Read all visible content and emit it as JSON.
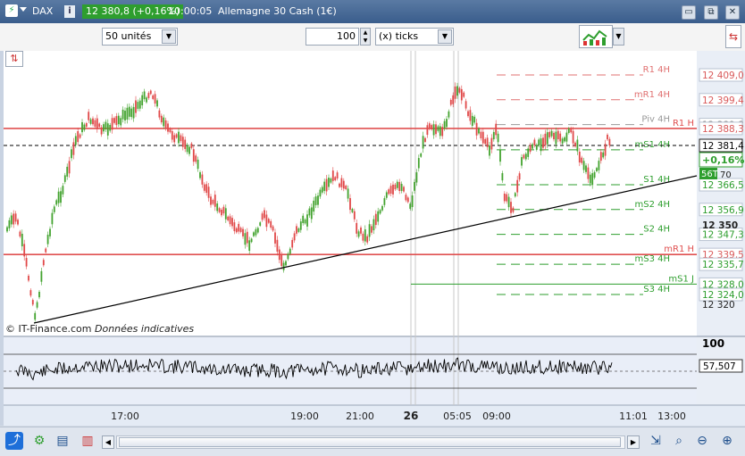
{
  "header": {
    "symbol": "DAX",
    "info": "i",
    "price_badge": "12 380,8 (+0,16%)",
    "time": "10:00:05",
    "instrument": "Allemagne 30 Cash (1€)",
    "window_buttons": [
      "▭",
      "⧉",
      "✕"
    ]
  },
  "toolbar": {
    "units_value": "50 unités",
    "ticks_value": "100",
    "ticks_unit": "(x) ticks"
  },
  "chart": {
    "watermark": "© IT-Finance.com",
    "watermark_note": "Données indicatives",
    "price_labels": [
      {
        "text": "12 409,0",
        "price": 12409.0,
        "color": "#d95a5a"
      },
      {
        "text": "12 399,4",
        "price": 12399.4,
        "color": "#d95a5a"
      },
      {
        "text": "12 389,8",
        "price": 12389.8,
        "color": "#888888"
      },
      {
        "text": "12 388,3",
        "price": 12388.3,
        "color": "#d95a5a"
      },
      {
        "text": "12 366,5",
        "price": 12366.5,
        "color": "#2e9e2e"
      },
      {
        "text": "12 356,9",
        "price": 12356.9,
        "color": "#2e9e2e"
      },
      {
        "text": "12 347,3",
        "price": 12347.3,
        "color": "#2e9e2e"
      },
      {
        "text": "12 339,5",
        "price": 12339.5,
        "color": "#d95a5a"
      },
      {
        "text": "12 335,7",
        "price": 12335.7,
        "color": "#2e9e2e"
      },
      {
        "text": "12 328,0",
        "price": 12328.0,
        "color": "#2e9e2e"
      },
      {
        "text": "12 324,0",
        "price": 12324.0,
        "color": "#2e9e2e"
      }
    ],
    "axis_ticks": [
      "12 350",
      "12 320"
    ],
    "last_price": "12 381,4",
    "change_badge": "+0,16%",
    "timer": "56T",
    "timer_extra": "70",
    "levels": [
      {
        "name": "R1 4H",
        "price": 12409.0,
        "color": "#e07070"
      },
      {
        "name": "mR1 4H",
        "price": 12399.4,
        "color": "#e07070"
      },
      {
        "name": "Piv 4H",
        "price": 12389.8,
        "color": "#999999"
      },
      {
        "name": "R1 H",
        "price": 12388.3,
        "color": "#e05050"
      },
      {
        "name": "mS1 4H",
        "price": 12380.0,
        "color": "#2e9e2e"
      },
      {
        "name": "S1 4H",
        "price": 12366.5,
        "color": "#2e9e2e"
      },
      {
        "name": "mS2 4H",
        "price": 12356.9,
        "color": "#2e9e2e"
      },
      {
        "name": "S2 4H",
        "price": 12347.3,
        "color": "#2e9e2e"
      },
      {
        "name": "mR1 H",
        "price": 12339.5,
        "color": "#e05050"
      },
      {
        "name": "mS3 4H",
        "price": 12335.7,
        "color": "#2e9e2e"
      },
      {
        "name": "mS1 J",
        "price": 12328.0,
        "color": "#2e9e2e"
      },
      {
        "name": "S3 4H",
        "price": 12324.0,
        "color": "#2e9e2e"
      }
    ],
    "rsi": {
      "top_label": "100",
      "value_label": "57,507"
    },
    "time_labels": [
      "17:00",
      "19:00",
      "21:00",
      "26",
      "05:05",
      "09:00",
      "11:01",
      "13:00"
    ]
  },
  "bottom": {
    "icons": [
      "share-icon",
      "indicators-icon",
      "table-icon",
      "color-bars-icon"
    ],
    "right_icons": [
      "scroll-right-icon",
      "cursor-icon",
      "zoom-box-icon",
      "zoom-out-icon",
      "zoom-in-icon"
    ]
  }
}
